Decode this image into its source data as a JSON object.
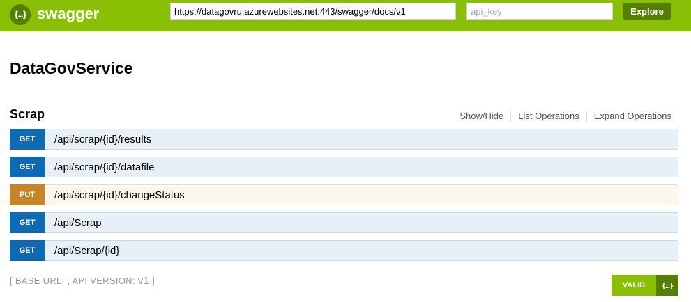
{
  "header": {
    "logo_icon": "swagger-braces-icon",
    "logo_glyph": "{…}",
    "brand": "swagger",
    "url_value": "https://datagovru.azurewebsites.net:443/swagger/docs/v1",
    "api_key_placeholder": "api_key",
    "explore_label": "Explore",
    "accent_color": "#89bf04",
    "dark_color": "#547f00"
  },
  "page_title": "DataGovService",
  "section": {
    "title": "Scrap",
    "links": {
      "show_hide": "Show/Hide",
      "list_operations": "List Operations",
      "expand_operations": "Expand Operations"
    }
  },
  "operations": [
    {
      "method": "GET",
      "path": "/api/scrap/{id}/results"
    },
    {
      "method": "GET",
      "path": "/api/scrap/{id}/datafile"
    },
    {
      "method": "PUT",
      "path": "/api/scrap/{id}/changeStatus"
    },
    {
      "method": "GET",
      "path": "/api/Scrap"
    },
    {
      "method": "GET",
      "path": "/api/Scrap/{id}"
    }
  ],
  "colors": {
    "get": "#0f6ab4",
    "put": "#c5862b"
  },
  "footer": {
    "open_bracket": "[",
    "base_url_label": "BASE URL: , API VERSION:",
    "version": "v1",
    "close_bracket": "]",
    "valid_label": "VALID",
    "valid_icon": "swagger-braces-icon",
    "valid_glyph": "{…}"
  }
}
